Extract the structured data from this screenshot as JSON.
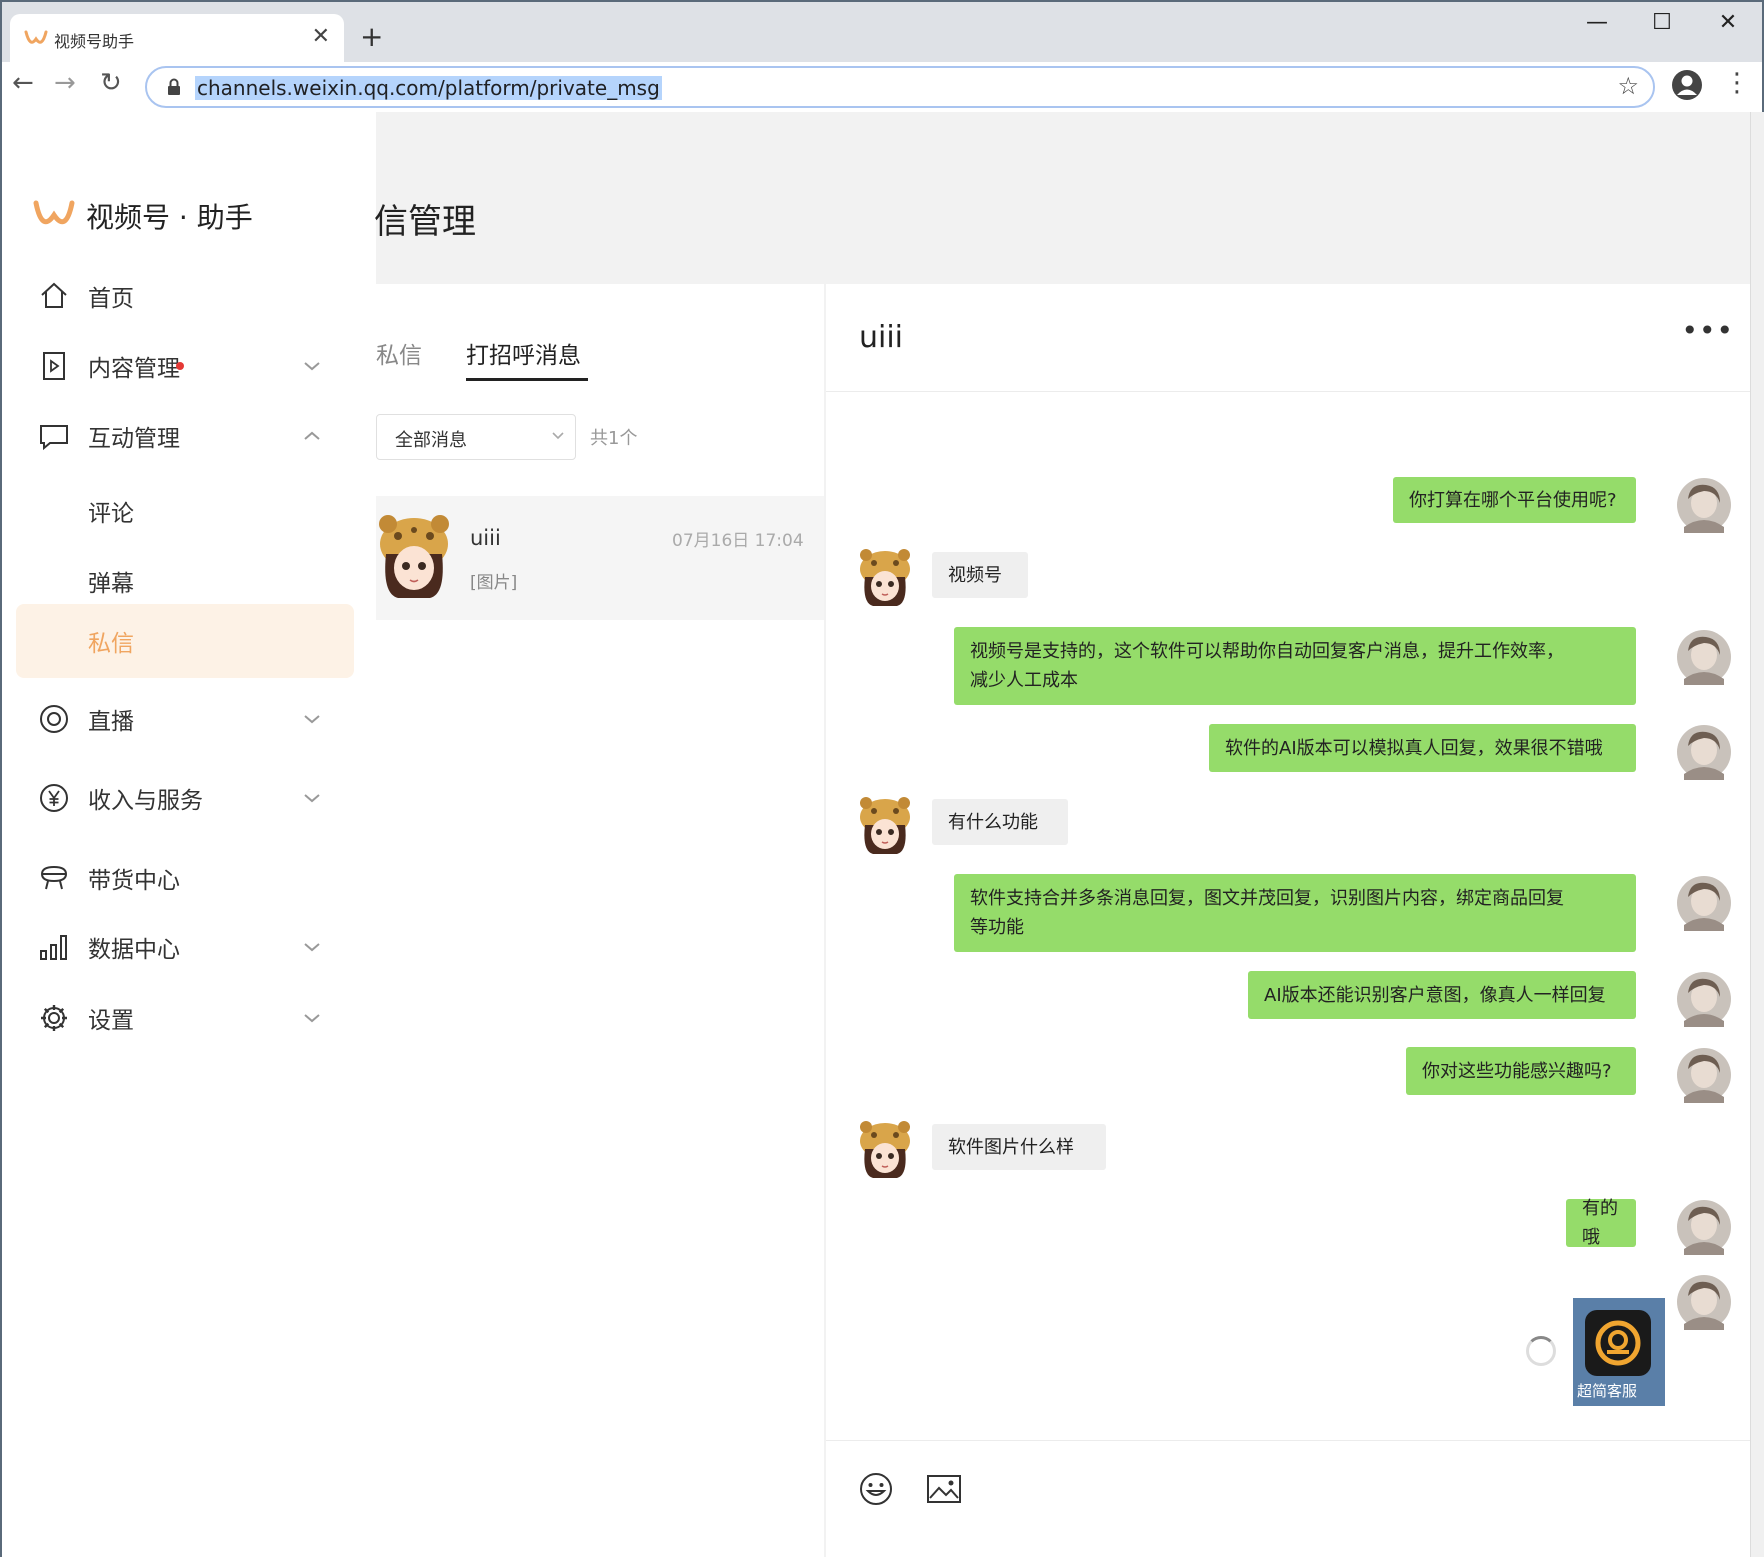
{
  "browser": {
    "tab_title": "视频号助手",
    "tab_close": "✕",
    "new_tab": "+",
    "url": "channels.weixin.qq.com/platform/private_msg",
    "window_min": "—",
    "window_max": "☐",
    "window_close": "✕",
    "back": "←",
    "forward": "→",
    "reload": "↻",
    "star": "☆",
    "menu": "⋮"
  },
  "sidebar": {
    "brand": "视频号 · 助手",
    "items": [
      {
        "label": "首页",
        "icon": "home-icon"
      },
      {
        "label": "内容管理",
        "icon": "play-doc-icon",
        "has_dot": true,
        "chevron": "down"
      },
      {
        "label": "互动管理",
        "icon": "chat-bubble-icon",
        "chevron": "up"
      },
      {
        "label": "评论"
      },
      {
        "label": "弹幕"
      },
      {
        "label": "私信",
        "active": true
      },
      {
        "label": "直播",
        "icon": "live-icon",
        "chevron": "down"
      },
      {
        "label": "收入与服务",
        "icon": "yuan-icon",
        "chevron": "down"
      },
      {
        "label": "带货中心",
        "icon": "shop-icon"
      },
      {
        "label": "数据中心",
        "icon": "bar-chart-icon",
        "chevron": "down"
      },
      {
        "label": "设置",
        "icon": "gear-icon",
        "chevron": "down"
      }
    ]
  },
  "header": {
    "title": "信管理"
  },
  "list": {
    "tabs": [
      "私信",
      "打招呼消息"
    ],
    "active_tab": "打招呼消息",
    "filter": "全部消息",
    "count": "共1个",
    "conversations": [
      {
        "name": "uiii",
        "preview": "[图片]",
        "time": "07月16日 17:04"
      }
    ]
  },
  "chat": {
    "title": "uiii",
    "more": "•••",
    "messages": [
      {
        "from": "self",
        "text": "你打算在哪个平台使用呢?"
      },
      {
        "from": "other",
        "text": "视频号"
      },
      {
        "from": "self",
        "text": "视频号是支持的，这个软件可以帮助你自动回复客户消息，提升工作效率，",
        "text2": "减少人工成本"
      },
      {
        "from": "self",
        "text": "软件的AI版本可以模拟真人回复，效果很不错哦"
      },
      {
        "from": "other",
        "text": "有什么功能"
      },
      {
        "from": "self",
        "text": "软件支持合并多条消息回复，图文并茂回复，识别图片内容，绑定商品回复",
        "text2": "等功能"
      },
      {
        "from": "self",
        "text": "AI版本还能识别客户意图，像真人一样回复"
      },
      {
        "from": "self",
        "text": "你对这些功能感兴趣吗?"
      },
      {
        "from": "other",
        "text": "软件图片什么样"
      },
      {
        "from": "self",
        "text": "有的哦"
      },
      {
        "from": "self",
        "type": "image",
        "caption": "超简客服"
      }
    ]
  },
  "colors": {
    "accent": "#f0a560",
    "bubble_out": "#95dc6a",
    "bubble_in": "#efefef",
    "active_bg": "#fdf2e6",
    "dot": "#e53935"
  }
}
